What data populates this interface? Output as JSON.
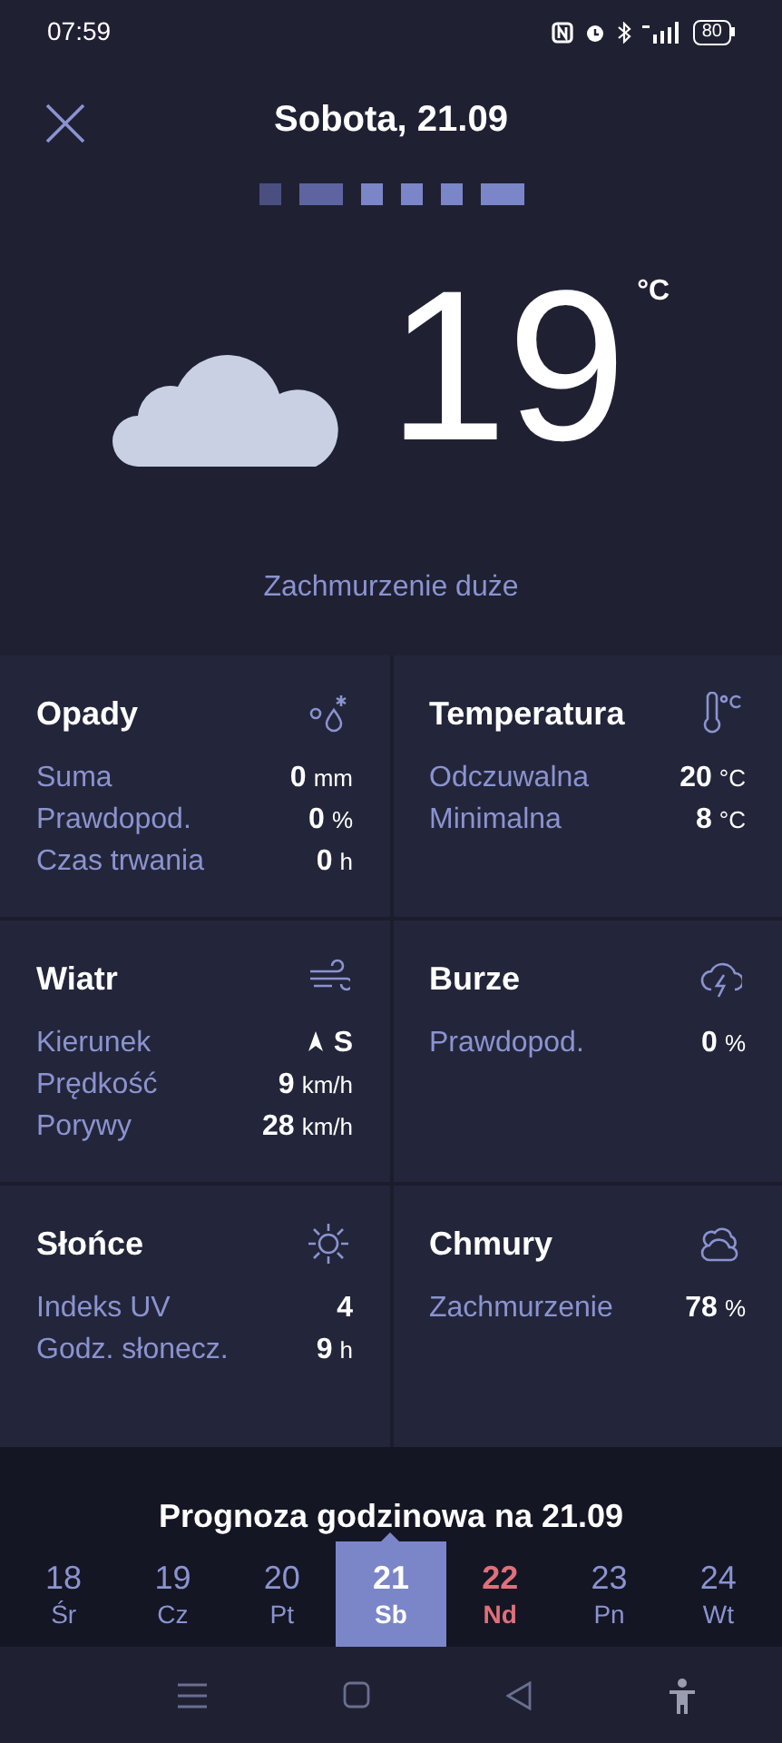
{
  "status_bar": {
    "time": "07:59",
    "battery": "80"
  },
  "header": {
    "title": "Sobota, 21.09"
  },
  "current": {
    "temperature": "19",
    "unit": "°C",
    "condition": "Zachmurzenie duże"
  },
  "panels": [
    {
      "title": "Opady",
      "kind": "precipitation",
      "rows": [
        {
          "label": "Suma",
          "value": "0",
          "unit": "mm"
        },
        {
          "label": "Prawdopod.",
          "value": "0",
          "unit": "%"
        },
        {
          "label": "Czas trwania",
          "value": "0",
          "unit": "h"
        }
      ]
    },
    {
      "title": "Temperatura",
      "kind": "thermometer",
      "rows": [
        {
          "label": "Odczuwalna",
          "value": "20",
          "unit": "°C"
        },
        {
          "label": "Minimalna",
          "value": "8",
          "unit": "°C"
        }
      ]
    },
    {
      "title": "Wiatr",
      "kind": "wind",
      "rows": [
        {
          "label": "Kierunek",
          "value": "S",
          "unit": "",
          "kind": "direction"
        },
        {
          "label": "Prędkość",
          "value": "9",
          "unit": "km/h"
        },
        {
          "label": "Porywy",
          "value": "28",
          "unit": "km/h"
        }
      ]
    },
    {
      "title": "Burze",
      "kind": "storm",
      "rows": [
        {
          "label": "Prawdopod.",
          "value": "0",
          "unit": "%"
        }
      ]
    },
    {
      "title": "Słońce",
      "kind": "sun",
      "rows": [
        {
          "label": "Indeks UV",
          "value": "4",
          "unit": ""
        },
        {
          "label": "Godz. słonecz.",
          "value": "9",
          "unit": "h"
        }
      ]
    },
    {
      "title": "Chmury",
      "kind": "clouds",
      "rows": [
        {
          "label": "Zachmurzenie",
          "value": "78",
          "unit": "%"
        }
      ]
    }
  ],
  "hourly": {
    "title": "Prognoza godzinowa na 21.09",
    "days": [
      {
        "number": "18",
        "weekday": "Śr",
        "selected": false,
        "holiday": false
      },
      {
        "number": "19",
        "weekday": "Cz",
        "selected": false,
        "holiday": false
      },
      {
        "number": "20",
        "weekday": "Pt",
        "selected": false,
        "holiday": false
      },
      {
        "number": "21",
        "weekday": "Sb",
        "selected": true,
        "holiday": false
      },
      {
        "number": "22",
        "weekday": "Nd",
        "selected": false,
        "holiday": true
      },
      {
        "number": "23",
        "weekday": "Pn",
        "selected": false,
        "holiday": false
      },
      {
        "number": "24",
        "weekday": "Wt",
        "selected": false,
        "holiday": false
      }
    ]
  }
}
